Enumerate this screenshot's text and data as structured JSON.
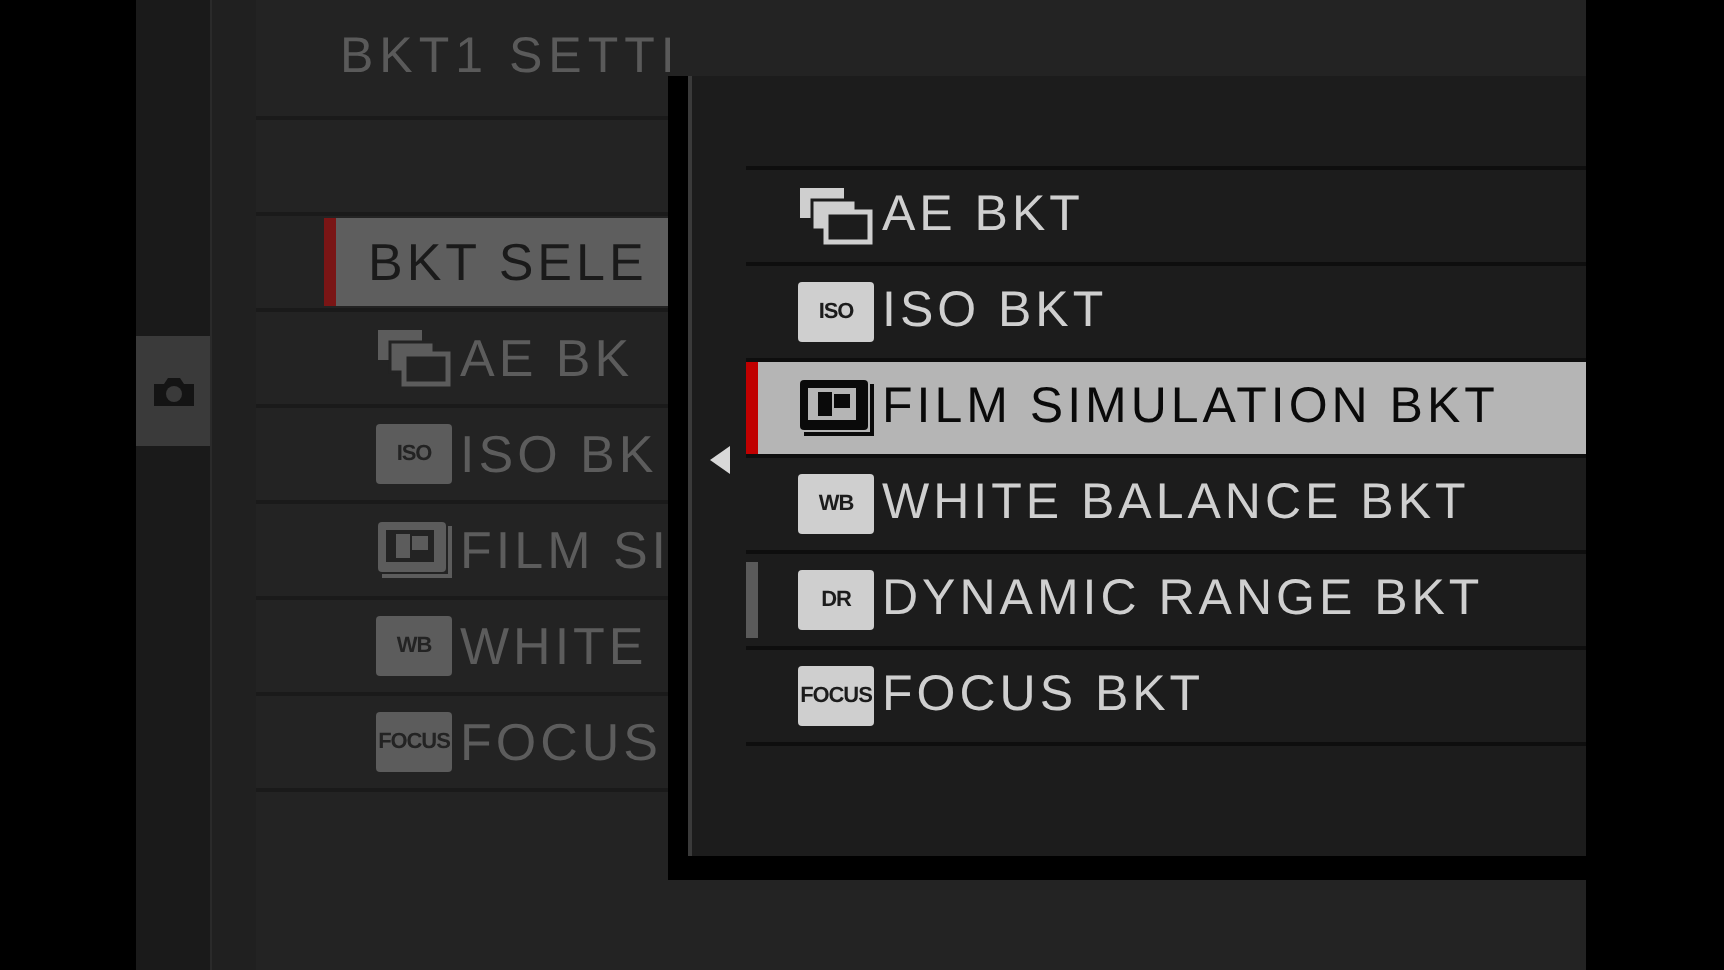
{
  "menu": {
    "title": "BKT1 SETTI",
    "items": [
      {
        "label": "BKT SELE",
        "kind": "plain",
        "selected": true
      },
      {
        "label": "AE BK",
        "kind": "ae",
        "selected": false
      },
      {
        "label": "ISO BK",
        "kind": "badge",
        "badge": "ISO",
        "selected": false
      },
      {
        "label": "FILM SI",
        "kind": "film",
        "selected": false
      },
      {
        "label": "WHITE",
        "kind": "badge",
        "badge": "WB",
        "selected": false
      },
      {
        "label": "FOCUS",
        "kind": "badge",
        "badge": "FOCUS",
        "selected": false
      }
    ]
  },
  "popup": {
    "items": [
      {
        "label": "AE BKT",
        "kind": "ae",
        "selected": false,
        "current": false
      },
      {
        "label": "ISO BKT",
        "kind": "badge",
        "badge": "ISO",
        "selected": false,
        "current": false
      },
      {
        "label": "FILM SIMULATION BKT",
        "kind": "film",
        "selected": true,
        "current": false
      },
      {
        "label": "WHITE BALANCE BKT",
        "kind": "badge",
        "badge": "WB",
        "selected": false,
        "current": false
      },
      {
        "label": "DYNAMIC RANGE BKT",
        "kind": "badge",
        "badge": "DR",
        "selected": false,
        "current": true
      },
      {
        "label": "FOCUS BKT",
        "kind": "badge",
        "badge": "FOCUS",
        "selected": false,
        "current": false
      }
    ]
  }
}
